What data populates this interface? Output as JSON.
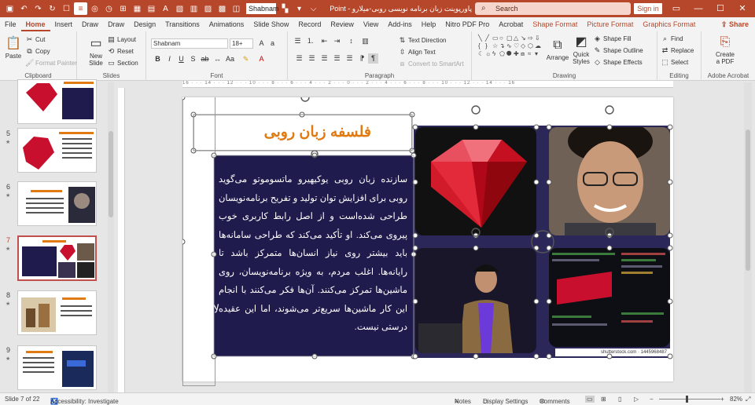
{
  "title_bar": {
    "doc_title": "پاورپوینت زبان برنامه نویسی روبی-میلارو",
    "app_name": "PowerPoint",
    "search_placeholder": "Search",
    "sign_in": "Sign in",
    "font_name": "Shabnam"
  },
  "menu": {
    "tabs": [
      "File",
      "Home",
      "Insert",
      "Draw",
      "Draw",
      "Design",
      "Transitions",
      "Animations",
      "Slide Show",
      "Record",
      "Review",
      "View",
      "Add-ins",
      "Help",
      "Nitro PDF Pro",
      "Acrobat",
      "Shape Format",
      "Picture Format",
      "Graphics Format"
    ],
    "active_tab": "Home",
    "share": "Share"
  },
  "ribbon": {
    "clipboard": {
      "label": "Clipboard",
      "paste": "Paste",
      "cut": "Cut",
      "copy": "Copy",
      "format_painter": "Format Painter"
    },
    "slides": {
      "label": "Slides",
      "new_slide_1": "New",
      "new_slide_2": "Slide",
      "layout": "Layout",
      "reset": "Reset",
      "section": "Section"
    },
    "font": {
      "label": "Font",
      "font_name": "Shabnam",
      "font_size": "18+"
    },
    "paragraph": {
      "label": "Paragraph",
      "text_direction": "Text Direction",
      "align_text": "Align Text",
      "convert_smartart": "Convert to SmartArt"
    },
    "drawing": {
      "label": "Drawing",
      "arrange": "Arrange",
      "quick_styles_1": "Quick",
      "quick_styles_2": "Styles",
      "shape_fill": "Shape Fill",
      "shape_outline": "Shape Outline",
      "shape_effects": "Shape Effects"
    },
    "editing": {
      "label": "Editing",
      "find": "Find",
      "replace": "Replace",
      "select": "Select"
    },
    "adobe": {
      "label": "Adobe Acrobat",
      "create_pdf_1": "Create",
      "create_pdf_2": "a PDF"
    }
  },
  "thumbnails": [
    {
      "num": "",
      "star": ""
    },
    {
      "num": "5",
      "star": "★"
    },
    {
      "num": "6",
      "star": "★"
    },
    {
      "num": "7",
      "star": "★",
      "selected": true
    },
    {
      "num": "8",
      "star": "★"
    },
    {
      "num": "9",
      "star": "★"
    }
  ],
  "slide": {
    "title": "فلسفه زبان روبی",
    "body": "سازنده زبان روبی یوکیهیرو ماتسوموتو می‌گوید روبی برای افزایش توان تولید و تفریح برنامه‌نویسان طراحی شده‌است و از اصل رابط کاربری خوب پیروی می‌کند. او تأکید می‌کند که طراحی سامانه‌ها باید بیشتر روی نیاز انسان‌ها متمرکز باشد تا رایانه‌ها. اغلب مردم، به ویژه برنامه‌نویسان، روی ماشین‌ها تمرکز می‌کنند. آن‌ها فکر می‌کنند با انجام این کار ماشین‌ها سریع‌تر می‌شوند، اما این عقیده درستی نیست.",
    "ruby_sign": "Ruby",
    "watermark": "shutterstock.com · 1445968487"
  },
  "status": {
    "slide_info": "Slide 7 of 22",
    "accessibility": "Accessibility: Investigate",
    "notes": "Notes",
    "display_settings": "Display Settings",
    "comments": "Comments",
    "zoom": "82%"
  },
  "colors": {
    "brand": "#b7472a",
    "slide_navy": "#1f1b4d",
    "title_orange": "#e07a12"
  }
}
